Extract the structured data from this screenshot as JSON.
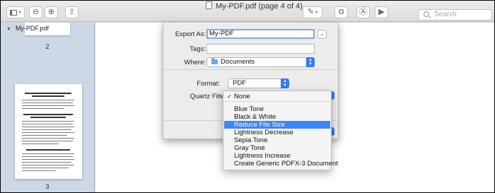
{
  "window": {
    "title": "My-PDF.pdf (page 4 of 4)",
    "search_placeholder": "Search"
  },
  "toolbar": {
    "sidebar_button_icon": "sidebar-icon",
    "zoom_out_icon": "zoom-out-icon",
    "zoom_in_icon": "zoom-in-icon",
    "share_icon": "share-icon",
    "markup_icon": "pen-icon",
    "rotate_icon": "rotate-icon",
    "annotate_icon": "annotate-icon",
    "slideshow_icon": "play-icon"
  },
  "sidebar": {
    "file_name": "My-PDF.pdf",
    "page_labels": [
      "2",
      "3"
    ]
  },
  "export_sheet": {
    "export_as_label": "Export As:",
    "export_as_value": "My-PDF",
    "tags_label": "Tags:",
    "tags_value": "",
    "where_label": "Where:",
    "where_value": "Documents",
    "format_label": "Format:",
    "format_value": "PDF",
    "quartz_filter_label": "Quartz Filter"
  },
  "quartz_menu": {
    "items": [
      {
        "label": "None",
        "checked": true,
        "selected": false
      },
      {
        "label": "Blue Tone",
        "checked": false,
        "selected": false
      },
      {
        "label": "Black & White",
        "checked": false,
        "selected": false
      },
      {
        "label": "Reduce File Size",
        "checked": false,
        "selected": true
      },
      {
        "label": "Lightness Decrease",
        "checked": false,
        "selected": false
      },
      {
        "label": "Sepia Tone",
        "checked": false,
        "selected": false
      },
      {
        "label": "Gray Tone",
        "checked": false,
        "selected": false
      },
      {
        "label": "Lightness Increase",
        "checked": false,
        "selected": false
      },
      {
        "label": "Create Generic PDFX-3 Document",
        "checked": false,
        "selected": false
      }
    ]
  },
  "colors": {
    "accent": "#3b86f7",
    "sidebar_bg": "#cdd8e6",
    "focus_ring": "#7fa9e4"
  }
}
